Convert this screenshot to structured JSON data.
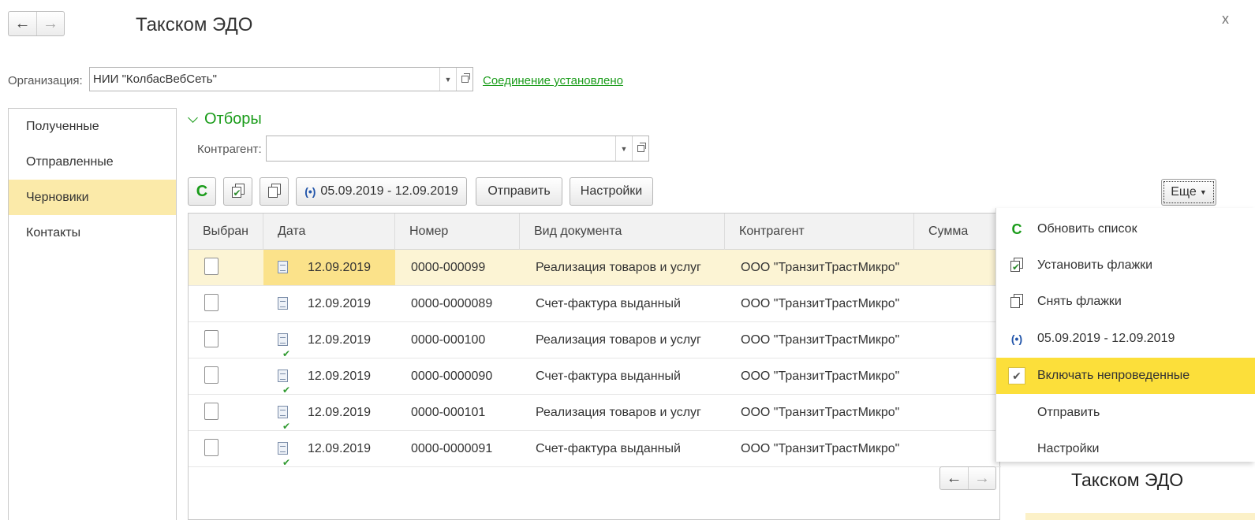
{
  "window": {
    "title": "Такском ЭДО",
    "close_glyph": "x",
    "nav": {
      "back_glyph": "←",
      "forward_glyph": "→"
    }
  },
  "organization": {
    "label": "Организация:",
    "value": "НИИ \"КолбасВебСеть\"",
    "dropdown_glyph": "▼",
    "connection_status": "Соединение установлено"
  },
  "sidebar": {
    "items": [
      {
        "label": "Полученные",
        "active": false
      },
      {
        "label": "Отправленные",
        "active": false
      },
      {
        "label": "Черновики",
        "active": true
      },
      {
        "label": "Контакты",
        "active": false
      }
    ]
  },
  "filters": {
    "toggle_label": "Отборы",
    "counterparty_label": "Контрагент:",
    "counterparty_value": "",
    "dropdown_glyph": "▼"
  },
  "toolbar": {
    "refresh_glyph": "C",
    "period_glyph": "(•)",
    "period_label": "05.09.2019 - 12.09.2019",
    "send_label": "Отправить",
    "settings_label": "Настройки",
    "more_label": "Еще",
    "more_caret": "▼"
  },
  "table": {
    "columns": [
      "Выбран",
      "Дата",
      "Номер",
      "Вид документа",
      "Контрагент",
      "Сумма"
    ],
    "rows": [
      {
        "date": "12.09.2019",
        "number": "0000-000099",
        "doc_type": "Реализация товаров и услуг",
        "counterparty": "ООО \"ТранзитТрастМикро\"",
        "posted": false
      },
      {
        "date": "12.09.2019",
        "number": "0000-0000089",
        "doc_type": "Счет-фактура выданный",
        "counterparty": "ООО \"ТранзитТрастМикро\"",
        "posted": false
      },
      {
        "date": "12.09.2019",
        "number": "0000-000100",
        "doc_type": "Реализация товаров и услуг",
        "counterparty": "ООО \"ТранзитТрастМикро\"",
        "posted": true
      },
      {
        "date": "12.09.2019",
        "number": "0000-0000090",
        "doc_type": "Счет-фактура выданный",
        "counterparty": "ООО \"ТранзитТрастМикро\"",
        "posted": true
      },
      {
        "date": "12.09.2019",
        "number": "0000-000101",
        "doc_type": "Реализация товаров и услуг",
        "counterparty": "ООО \"ТранзитТрастМикро\"",
        "posted": true
      },
      {
        "date": "12.09.2019",
        "number": "0000-0000091",
        "doc_type": "Счет-фактура выданный",
        "counterparty": "ООО \"ТранзитТрастМикро\"",
        "posted": true
      }
    ]
  },
  "more_menu": {
    "items": [
      {
        "label": "Обновить список",
        "icon": "refresh-icon"
      },
      {
        "label": "Установить флажки",
        "icon": "check-all-icon"
      },
      {
        "label": "Снять флажки",
        "icon": "uncheck-all-icon"
      },
      {
        "label": "05.09.2019 - 12.09.2019",
        "icon": "period-icon"
      },
      {
        "label": "Включать непроведенные",
        "icon": "checkmark-icon",
        "checked": true
      },
      {
        "label": "Отправить",
        "icon": ""
      },
      {
        "label": "Настройки",
        "icon": ""
      }
    ],
    "checkmark_glyph": "✔"
  },
  "second_window": {
    "title": "Такском ЭДО"
  },
  "colors": {
    "accent_green": "#1a9c1a",
    "selected_row": "#fcf4d4",
    "current_cell": "#fbe28a",
    "sidebar_active": "#fbeaa9",
    "menu_checked": "#fcdf3a"
  }
}
